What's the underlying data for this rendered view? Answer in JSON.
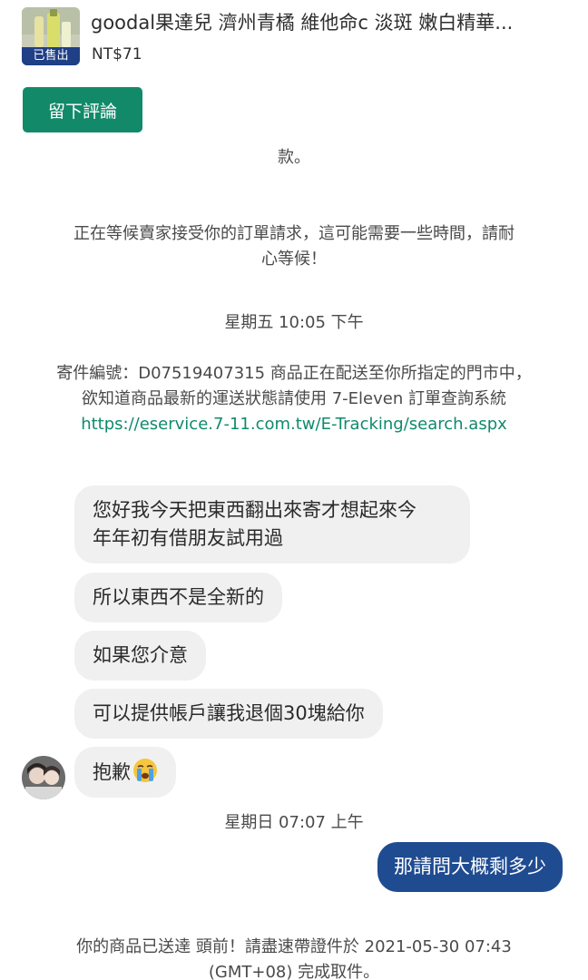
{
  "product": {
    "title": "goodal果達兒 濟州青橘 維他命c 淡斑 嫩白精華...",
    "price": "NT$71",
    "sold_badge": "已售出",
    "thumb_icon": "product-bottle-photo"
  },
  "review_button": {
    "label": "留下評論"
  },
  "system": {
    "fragment": "款。",
    "waiting_line1": "正在等候賣家接受你的訂單請求，這可能需要一些時間，請耐",
    "waiting_line2": "心等候！",
    "timestamp1": "星期五 10:05 下午",
    "shipping_line1": "寄件編號：D07519407315 商品正在配送至你所指定的門市中，",
    "shipping_line2": "欲知道商品最新的運送狀態請使用 7-Eleven 訂單查詢系統",
    "shipping_link": "https://eservice.7-11.com.tw/E-Tracking/search.aspx",
    "timestamp2": "星期日 07:07 上午",
    "delivered_line1": "你的商品已送達 頭前！請盡速帶證件於 2021-05-30 07:43",
    "delivered_line2": "(GMT+08) 完成取件。"
  },
  "messages": {
    "m1_line1": "您好我今天把東西翻出來寄才想起來今",
    "m1_line2": "年年初有借朋友試用過",
    "m2": "所以東西不是全新的",
    "m3": "如果您介意",
    "m4": "可以提供帳戶讓我退個30塊給你",
    "m5": "抱歉",
    "m5_emoji": "crying-face-emoji",
    "out1": "那請問大概剩多少"
  },
  "colors": {
    "accent_green": "#128a6a",
    "link_green": "#0f8a6c",
    "outgoing_bubble": "#1f4b91",
    "incoming_bubble": "#f0f0f0",
    "sold_badge": "#1f3f86"
  }
}
